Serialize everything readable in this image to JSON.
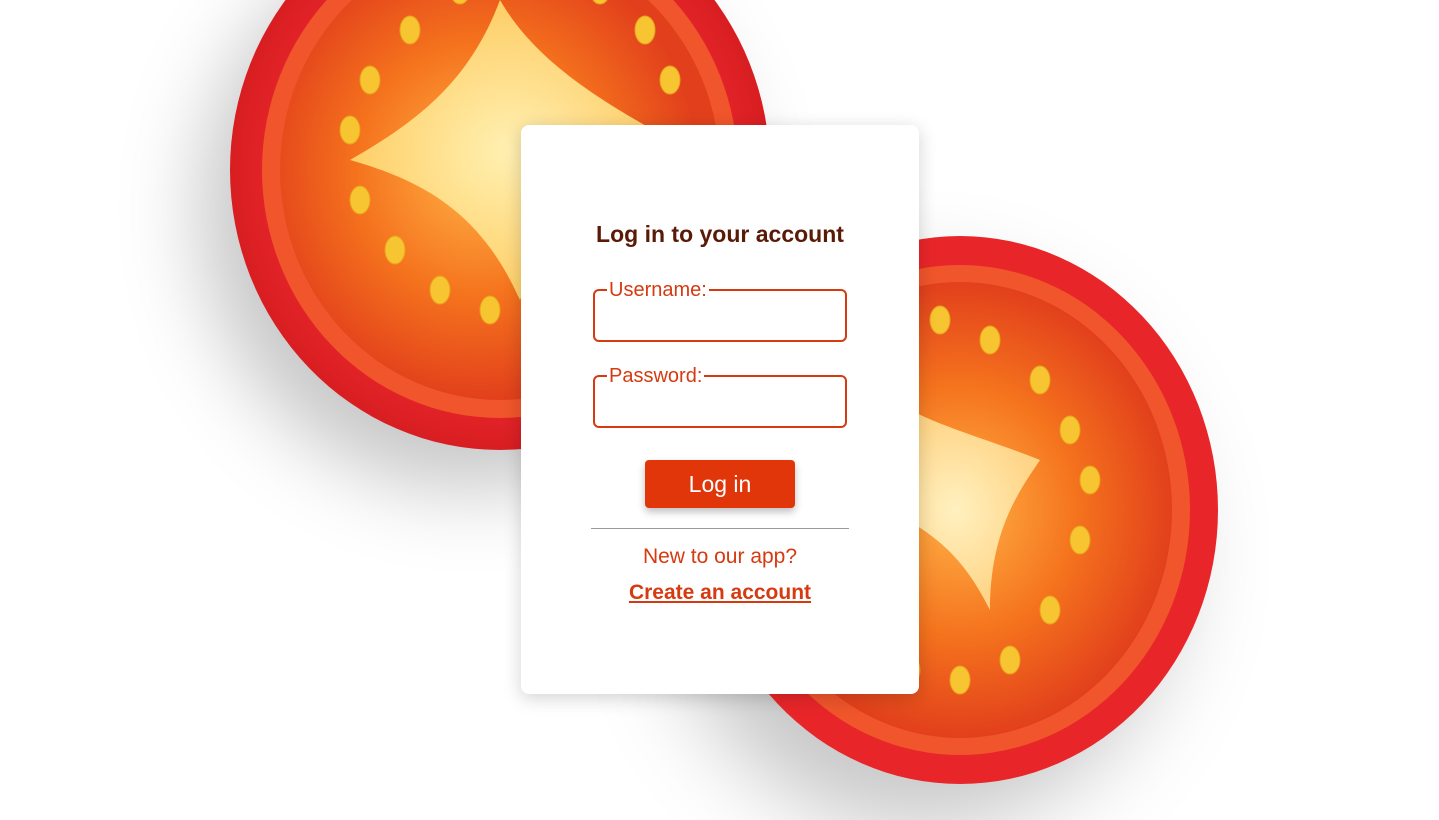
{
  "login": {
    "title": "Log in to your account",
    "username_label": "Username:",
    "username_value": "",
    "password_label": "Password:",
    "password_value": "",
    "submit_label": "Log in",
    "signup_prompt": "New to our app?",
    "signup_link": "Create an account"
  },
  "colors": {
    "accent": "#e0360a",
    "label": "#d63a10",
    "title": "#5a1a08",
    "card": "#ffffff",
    "background": "#ffffff"
  },
  "background": {
    "icon": "tomato-halves-photo"
  }
}
